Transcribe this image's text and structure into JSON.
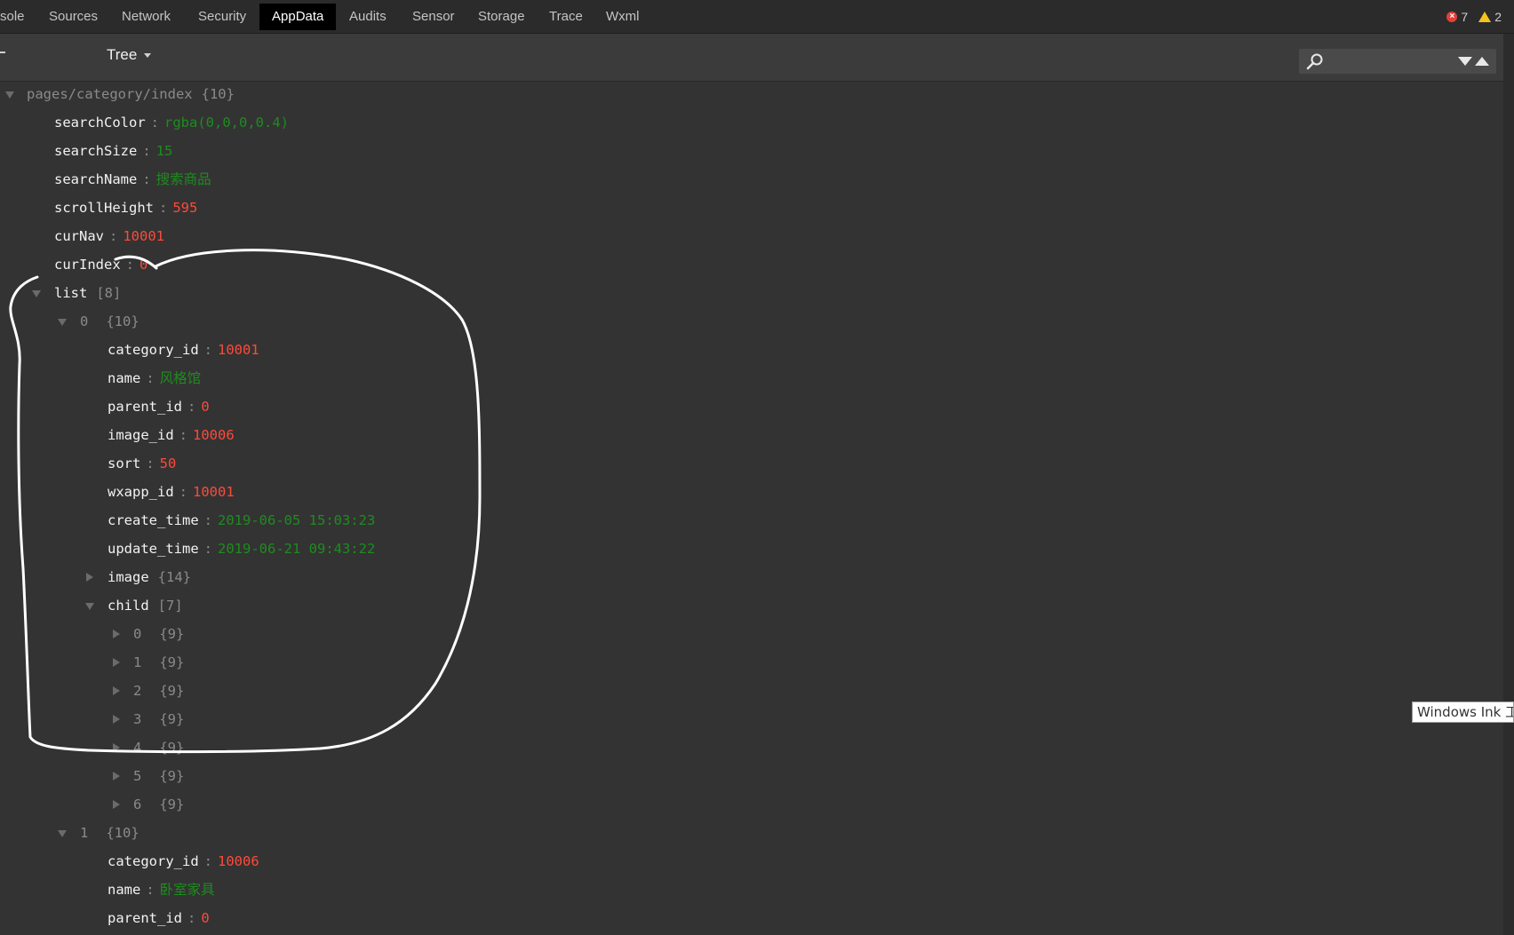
{
  "tabs": [
    {
      "label": "sole",
      "active": false
    },
    {
      "label": "Sources",
      "active": false
    },
    {
      "label": "Network",
      "active": false
    },
    {
      "label": "Security",
      "active": false
    },
    {
      "label": "AppData",
      "active": true
    },
    {
      "label": "Audits",
      "active": false
    },
    {
      "label": "Sensor",
      "active": false
    },
    {
      "label": "Storage",
      "active": false
    },
    {
      "label": "Trace",
      "active": false
    },
    {
      "label": "Wxml",
      "active": false
    }
  ],
  "status": {
    "errors": "7",
    "warnings": "2"
  },
  "toolbar": {
    "view_mode": "Tree",
    "search_value": ""
  },
  "tree": {
    "root": {
      "path": "pages/category/index",
      "count": "{10}"
    },
    "rows": [
      {
        "key": "searchColor",
        "sep": ":",
        "value": "rgba(0,0,0,0.4)",
        "type": "str"
      },
      {
        "key": "searchSize",
        "sep": ":",
        "value": "15",
        "type": "str"
      },
      {
        "key": "searchName",
        "sep": ":",
        "value": "搜索商品",
        "type": "str"
      },
      {
        "key": "scrollHeight",
        "sep": ":",
        "value": "595",
        "type": "num"
      },
      {
        "key": "curNav",
        "sep": ":",
        "value": "10001",
        "type": "num"
      },
      {
        "key": "curIndex",
        "sep": ":",
        "value": "0",
        "type": "num"
      },
      {
        "key": "list",
        "count": "[8]"
      },
      {
        "key": "0",
        "count": "{10}"
      },
      {
        "key": "category_id",
        "sep": ":",
        "value": "10001",
        "type": "num"
      },
      {
        "key": "name",
        "sep": ":",
        "value": "风格馆",
        "type": "str"
      },
      {
        "key": "parent_id",
        "sep": ":",
        "value": "0",
        "type": "num"
      },
      {
        "key": "image_id",
        "sep": ":",
        "value": "10006",
        "type": "num"
      },
      {
        "key": "sort",
        "sep": ":",
        "value": "50",
        "type": "num"
      },
      {
        "key": "wxapp_id",
        "sep": ":",
        "value": "10001",
        "type": "num"
      },
      {
        "key": "create_time",
        "sep": ":",
        "value": "2019-06-05 15:03:23",
        "type": "str"
      },
      {
        "key": "update_time",
        "sep": ":",
        "value": "2019-06-21 09:43:22",
        "type": "str"
      },
      {
        "key": "image",
        "count": "{14}"
      },
      {
        "key": "child",
        "count": "[7]"
      },
      {
        "key": "0",
        "count": "{9}"
      },
      {
        "key": "1",
        "count": "{9}"
      },
      {
        "key": "2",
        "count": "{9}"
      },
      {
        "key": "3",
        "count": "{9}"
      },
      {
        "key": "4",
        "count": "{9}"
      },
      {
        "key": "5",
        "count": "{9}"
      },
      {
        "key": "6",
        "count": "{9}"
      },
      {
        "key": "1",
        "count": "{10}"
      },
      {
        "key": "category_id",
        "sep": ":",
        "value": "10006",
        "type": "num"
      },
      {
        "key": "name",
        "sep": ":",
        "value": "卧室家具",
        "type": "str"
      },
      {
        "key": "parent_id",
        "sep": ":",
        "value": "0",
        "type": "num"
      }
    ]
  },
  "tooltip": "Windows Ink 工作区",
  "colors": {
    "number": "#ff4a3a",
    "string": "#1e8c1e",
    "background": "#333333",
    "active_tab": "#000000",
    "ink": "#ffffff"
  }
}
